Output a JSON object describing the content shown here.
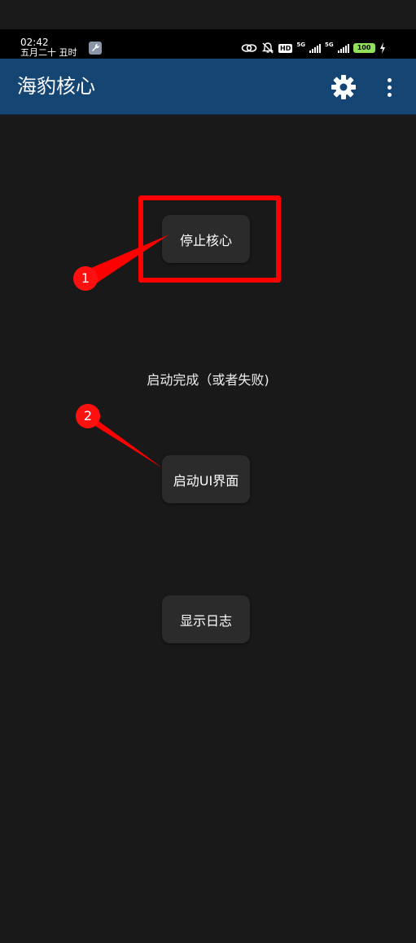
{
  "status_bar": {
    "time": "02:42",
    "date": "五月二十 丑时",
    "hd_label": "HD",
    "network_1": "5G",
    "network_2": "5G",
    "battery_level": "100"
  },
  "app_bar": {
    "title": "海豹核心",
    "settings_icon": "gear-icon",
    "menu_icon": "more-vert-icon"
  },
  "main": {
    "stop_core_label": "停止核心",
    "status_text": "启动完成（或者失败)",
    "launch_ui_label": "启动UI界面",
    "show_log_label": "显示日志"
  },
  "annotations": {
    "badge_1": "1",
    "badge_2": "2",
    "color": "#ff0000"
  },
  "colors": {
    "app_bar": "#154573",
    "background": "#191919",
    "button": "#2b2b2b"
  }
}
